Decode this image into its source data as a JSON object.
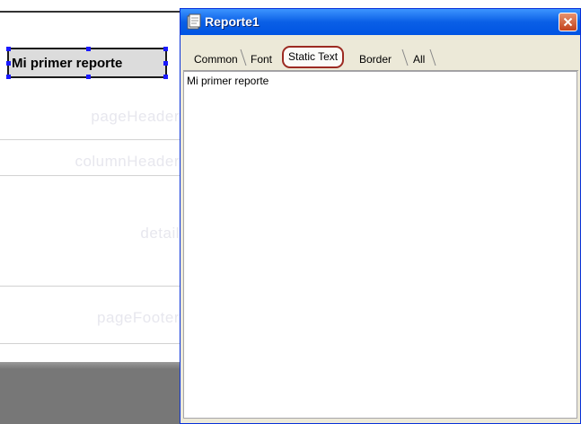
{
  "designer": {
    "selected_element_text": "Mi primer reporte",
    "bands": [
      "pageHeader",
      "columnHeader",
      "detail",
      "pageFooter"
    ]
  },
  "window": {
    "title": "Reporte1",
    "tabs": [
      {
        "label": "Common",
        "active": false
      },
      {
        "label": "Font",
        "active": false
      },
      {
        "label": "Static Text",
        "active": true
      },
      {
        "label": "Border",
        "active": false
      },
      {
        "label": "All",
        "active": false
      }
    ],
    "text_value": "Mi primer reporte"
  },
  "colors": {
    "titlebar": "#0054e3",
    "window_bg": "#ece9d8",
    "active_tab_outline": "#9c2b22",
    "close_button": "#c2421d"
  },
  "icons": {
    "window_icon": "report-icon",
    "close": "close-icon"
  }
}
